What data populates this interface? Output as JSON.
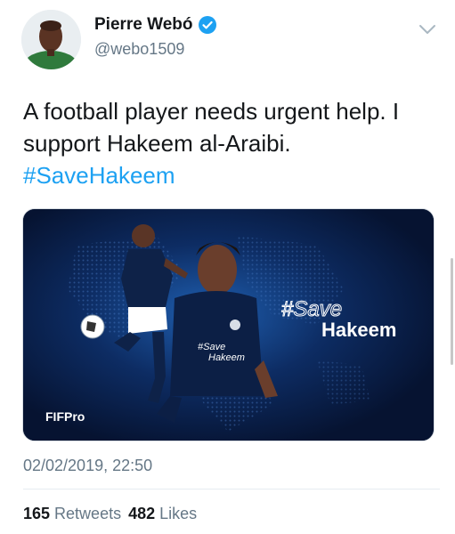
{
  "author": {
    "name": "Pierre Webó",
    "handle": "@webo1509"
  },
  "tweet": {
    "text": "A football player needs urgent help. I support Hakeem al-Araibi.",
    "hashtag": "#SaveHakeem",
    "timestamp": "02/02/2019, 22:50"
  },
  "media": {
    "headline_tag": "#Save",
    "headline_name": "Hakeem",
    "small_tag": "#Save",
    "small_name": "Hakeem",
    "brand": "FIFPro"
  },
  "stats": {
    "retweets_count": "165",
    "retweets_label": "Retweets",
    "likes_count": "482",
    "likes_label": "Likes"
  },
  "colors": {
    "link": "#1da1f2",
    "verified": "#1da1f2",
    "secondary_text": "#657786",
    "media_bg": "#071735"
  }
}
